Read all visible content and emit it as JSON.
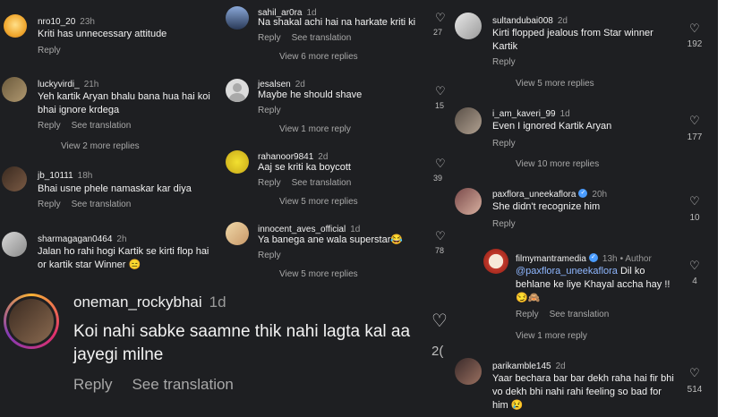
{
  "common": {
    "reply": "Reply",
    "see_translation": "See translation",
    "heart": "♡"
  },
  "p1": [
    {
      "user": "nro10_20",
      "time": "23h",
      "text": "Kriti has unnecessary attitude"
    },
    {
      "user": "luckyvirdi_",
      "time": "21h",
      "text": "Yeh kartik Aryan bhalu bana hua hai koi bhai ignore krdega",
      "more": "View 2 more replies"
    },
    {
      "user": "jb_10111",
      "time": "18h",
      "text": "Bhai usne phele namaskar kar diya"
    },
    {
      "user": "sharmagagan0464",
      "time": "2h",
      "text": "Jalan ho rahi hogi Kartik se kirti flop hai or kartik star Winner 😑"
    }
  ],
  "p2": [
    {
      "user": "sahil_ar0ra",
      "time": "1d",
      "text": "Na shakal achi hai na harkate kriti ki",
      "more": "View 6 more replies"
    },
    {
      "user": "jesalsen",
      "time": "2d",
      "text": "Maybe he should shave",
      "more": "View 1 more reply"
    },
    {
      "user": "rahanoor9841",
      "time": "2d",
      "text": "Aaj se kriti ka boycott",
      "more": "View 5 more replies"
    },
    {
      "user": "innocent_aves_official",
      "time": "1d",
      "text": "Ya banega ane wala superstar😂",
      "more": "View 5 more replies"
    }
  ],
  "p3": {
    "user": "oneman_rockybhai",
    "time": "1d",
    "text": "Koi nahi sabke saamne thik nahi lagta kal aa jayegi milne"
  },
  "p4": {
    "counts": [
      "27",
      "15",
      "39",
      "78",
      "2("
    ]
  },
  "p5": [
    {
      "user": "sultandubai008",
      "time": "2d",
      "text": "Kirti flopped jealous from Star winner Kartik",
      "likes": "192",
      "more": "View 5 more replies"
    },
    {
      "user": "i_am_kaveri_99",
      "time": "1d",
      "text": "Even I ignored Kartik Aryan",
      "likes": "177",
      "more": "View 10 more replies"
    },
    {
      "user": "paxflora_uneekaflora",
      "time": "20h",
      "text": "She didn't recognize him",
      "likes": "10"
    },
    {
      "user": "filmymantramedia",
      "time": "13h",
      "author": "• Author",
      "mention": "@paxflora_uneekaflora",
      "text": " Dil ko behlane ke liye Khayal accha hay !! 😏🙈",
      "likes": "4",
      "more": "View 1 more reply"
    },
    {
      "user": "parikamble145",
      "time": "2d",
      "text": "Yaar bechara bar bar dekh raha hai fir bhi vo dekh bhi nahi rahi feeling so bad for him 😢",
      "likes": "514"
    }
  ],
  "colors": {
    "panel_bg": "#1e1f22",
    "text": "#f2f2f2",
    "muted": "#a8a8a8",
    "link": "#8fb7ff",
    "verified": "#4a9cff"
  }
}
